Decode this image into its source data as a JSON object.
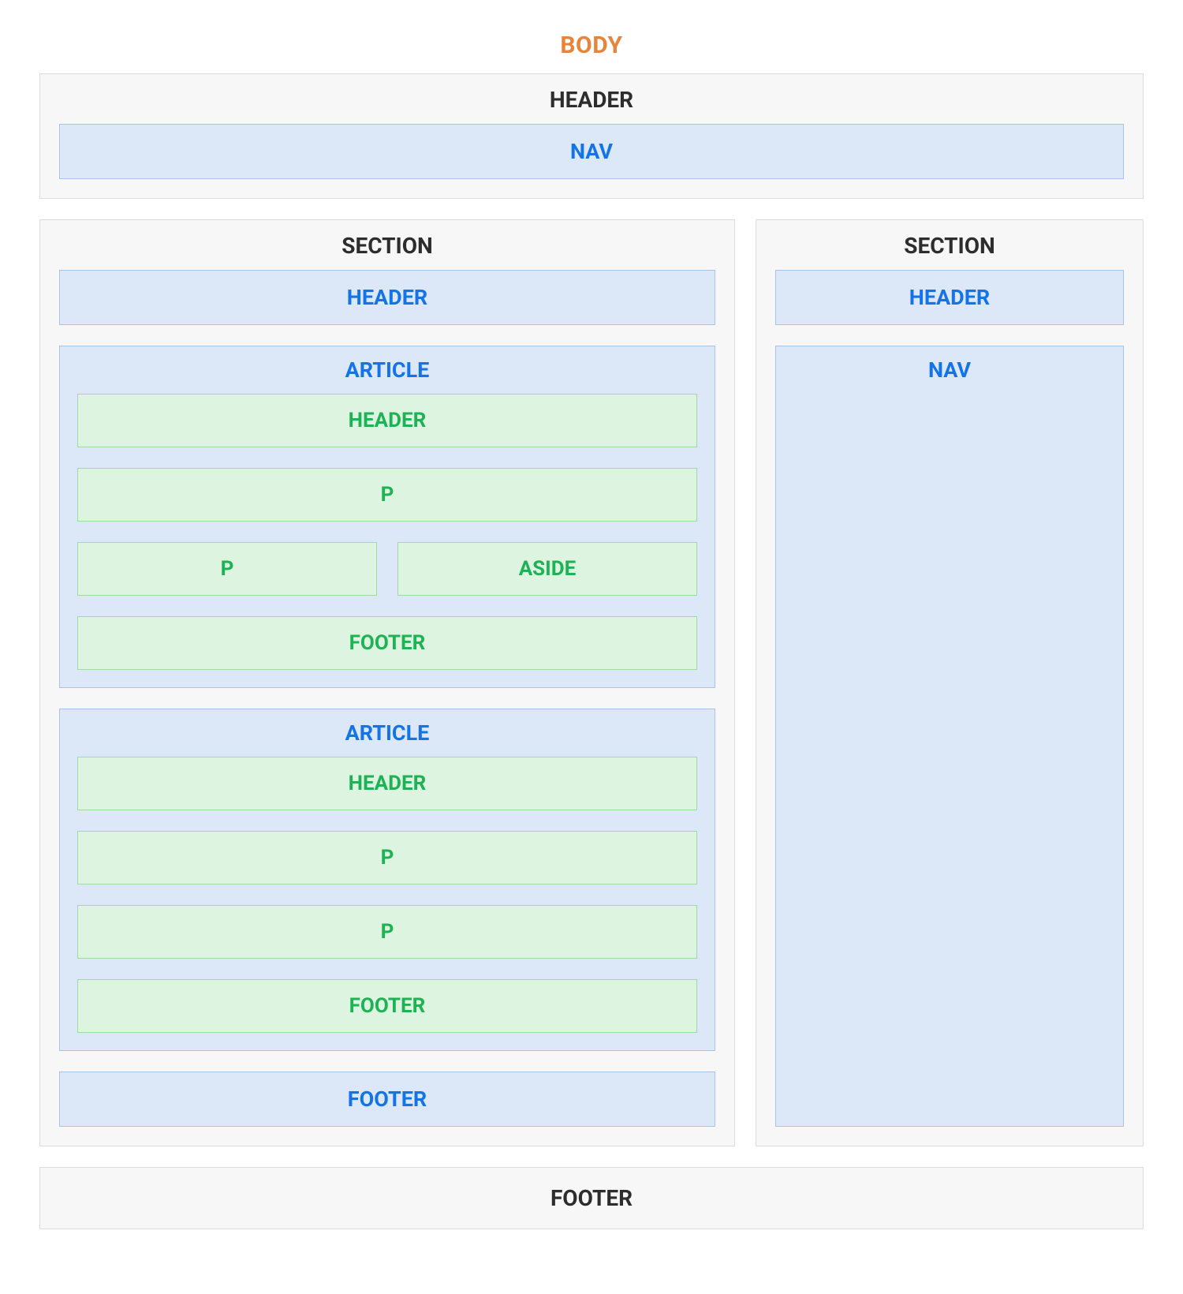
{
  "body_label": "BODY",
  "top_header": {
    "title": "HEADER",
    "nav": "NAV"
  },
  "left_section": {
    "title": "SECTION",
    "header": "HEADER",
    "articles": [
      {
        "title": "ARTICLE",
        "header": "HEADER",
        "p1": "P",
        "p2": "P",
        "aside": "ASIDE",
        "footer": "FOOTER",
        "has_aside": true
      },
      {
        "title": "ARTICLE",
        "header": "HEADER",
        "p1": "P",
        "p2": "P",
        "footer": "FOOTER",
        "has_aside": false
      }
    ],
    "footer": "FOOTER"
  },
  "right_section": {
    "title": "SECTION",
    "header": "HEADER",
    "nav": "NAV"
  },
  "page_footer": {
    "title": "FOOTER"
  }
}
